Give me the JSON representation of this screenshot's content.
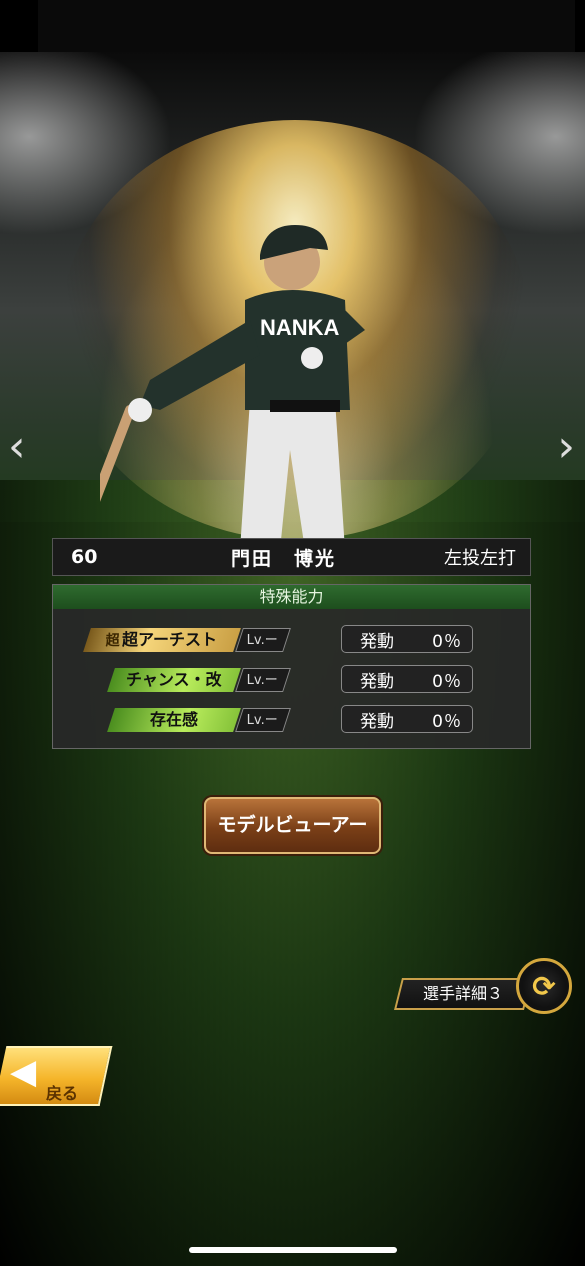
{
  "player": {
    "number": "60",
    "name": "門田　博光",
    "handedness": "左投左打",
    "jersey_text": "NANKA"
  },
  "abilities_panel": {
    "title": "特殊能力",
    "rows": [
      {
        "name": "超アーチスト",
        "badge": "超",
        "level": "Lv.ー",
        "activation_label": "発動",
        "activation_value": "0％",
        "color": "#f5d57a"
      },
      {
        "name": "チャンス・改",
        "level": "Lv.ー",
        "activation_label": "発動",
        "activation_value": "0％",
        "color": "#b9ec5c"
      },
      {
        "name": "存在感",
        "level": "Lv.ー",
        "activation_label": "発動",
        "activation_value": "0％",
        "color": "#b9ec5c"
      }
    ]
  },
  "buttons": {
    "model_viewer": "モデルビューアー",
    "player_detail": "選手詳細３",
    "back": "戻る"
  },
  "icons": {
    "prev": "‹",
    "next": "›",
    "swap": "⟳",
    "back_arrow": "◀"
  }
}
